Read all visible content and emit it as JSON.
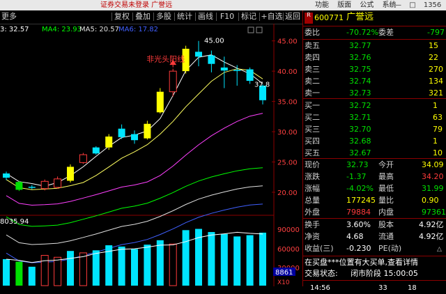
{
  "window": {
    "title": "证券交易未登录  广誉远"
  },
  "menu": [
    "功能",
    "版面",
    "公式",
    "系统"
  ],
  "window_controls": {
    "number": "1356"
  },
  "toolbar": {
    "more": "更多",
    "buttons": [
      "复权",
      "叠加",
      "多股",
      "统计",
      "画线",
      "F10",
      "标记",
      "+自选",
      "返回"
    ]
  },
  "indicator": {
    "ma3": "3: 32.57",
    "ma4": "MA4: 23.93",
    "ma5": "MA5: 20.57",
    "ma6": "MA6: 17.82"
  },
  "volume_label": "8035.94",
  "volume_axis": [
    "90000",
    "60000",
    "30000"
  ],
  "volume_axis_unit": "X10",
  "volume_box": "8861",
  "annotation": "非光头阳线",
  "colors": {
    "up": "#ff3b3b",
    "down": "#00e5ff",
    "yellow_candle": "#ffff00",
    "ma1": "#ffffff",
    "ma2": "#ffff60",
    "ma3": "#ff40ff",
    "ma4": "#00ff00",
    "ma5": "#e0e0e0",
    "ma6": "#4060ff"
  },
  "chart_data": {
    "type": "candlestick",
    "y_ticks": [
      45.0,
      40.0,
      35.0,
      30.0,
      25.0,
      20.0
    ],
    "high_label": "45.00",
    "last_label": "37.8",
    "ylim": [
      17,
      46
    ],
    "candles": [
      {
        "o": 22.4,
        "c": 23.1,
        "h": 23.4,
        "l": 22.0,
        "color": "cyan",
        "vol": 42000
      },
      {
        "o": 21.7,
        "c": 20.4,
        "h": 21.9,
        "l": 20.2,
        "color": "green",
        "vol": 38000
      },
      {
        "o": 20.9,
        "c": 20.8,
        "h": 21.2,
        "l": 20.5,
        "color": "cyan",
        "vol": 30000
      },
      {
        "o": 20.6,
        "c": 21.8,
        "h": 22.1,
        "l": 20.3,
        "color": "red",
        "vol": 48000
      },
      {
        "o": 20.8,
        "c": 22.2,
        "h": 22.6,
        "l": 20.6,
        "color": "red",
        "vol": 45000
      },
      {
        "o": 21.9,
        "c": 24.2,
        "h": 24.6,
        "l": 21.6,
        "color": "yellow",
        "vol": 55000
      },
      {
        "o": 24.9,
        "c": 26.2,
        "h": 26.5,
        "l": 24.7,
        "color": "red",
        "vol": 52000
      },
      {
        "o": 26.4,
        "c": 27.4,
        "h": 27.6,
        "l": 26.2,
        "color": "cyan",
        "vol": 56000
      },
      {
        "o": 27.4,
        "c": 29.2,
        "h": 29.6,
        "l": 27.0,
        "color": "yellow",
        "vol": 64000
      },
      {
        "o": 29.1,
        "c": 30.5,
        "h": 31.2,
        "l": 28.8,
        "color": "cyan",
        "vol": 62000
      },
      {
        "o": 29.6,
        "c": 28.6,
        "h": 30.2,
        "l": 28.0,
        "color": "cyan",
        "vol": 58000
      },
      {
        "o": 28.9,
        "c": 31.3,
        "h": 31.8,
        "l": 28.7,
        "color": "yellow",
        "vol": 65000
      },
      {
        "o": 33.2,
        "c": 36.6,
        "h": 37.2,
        "l": 33.0,
        "color": "yellow",
        "vol": 72000
      },
      {
        "o": 36.6,
        "c": 40.0,
        "h": 40.4,
        "l": 35.8,
        "color": "red",
        "vol": 66000
      },
      {
        "o": 40.0,
        "c": 43.7,
        "h": 44.2,
        "l": 39.6,
        "color": "yellow",
        "vol": 88000
      },
      {
        "o": 42.4,
        "c": 43.2,
        "h": 45.0,
        "l": 40.8,
        "color": "cyan",
        "vol": 90000
      },
      {
        "o": 42.6,
        "c": 41.2,
        "h": 43.4,
        "l": 39.8,
        "color": "cyan",
        "vol": 85000
      },
      {
        "o": 40.6,
        "c": 40.1,
        "h": 42.4,
        "l": 37.2,
        "color": "cyan",
        "vol": 82000
      },
      {
        "o": 40.2,
        "c": 40.2,
        "h": 41.0,
        "l": 37.6,
        "color": "cyan",
        "vol": 78000
      },
      {
        "o": 40.3,
        "c": 38.4,
        "h": 40.6,
        "l": 37.9,
        "color": "cyan",
        "vol": 80000
      },
      {
        "o": 37.6,
        "c": 35.2,
        "h": 37.8,
        "l": 34.5,
        "color": "cyan",
        "vol": 84000
      }
    ]
  },
  "quote": {
    "code": "600771",
    "name": "广誉远",
    "wb": {
      "label": "委比",
      "value": "-70.72%",
      "label2": "委差",
      "value2": "-797"
    },
    "sell": [
      {
        "label": "卖五",
        "price": "32.77",
        "vol": "15"
      },
      {
        "label": "卖四",
        "price": "32.76",
        "vol": "22"
      },
      {
        "label": "卖三",
        "price": "32.75",
        "vol": "270"
      },
      {
        "label": "卖二",
        "price": "32.74",
        "vol": "134"
      },
      {
        "label": "卖一",
        "price": "32.73",
        "vol": "321"
      }
    ],
    "buy": [
      {
        "label": "买一",
        "price": "32.72",
        "vol": "1"
      },
      {
        "label": "买二",
        "price": "32.71",
        "vol": "63"
      },
      {
        "label": "买三",
        "price": "32.70",
        "vol": "79"
      },
      {
        "label": "买四",
        "price": "32.68",
        "vol": "1"
      },
      {
        "label": "买五",
        "price": "32.67",
        "vol": "10"
      }
    ],
    "stats": [
      {
        "l1": "现价",
        "v1": "32.73",
        "c1": "green",
        "l2": "今开",
        "v2": "34.09",
        "c2": "yellow"
      },
      {
        "l1": "涨跌",
        "v1": "-1.37",
        "c1": "green",
        "l2": "最高",
        "v2": "34.20",
        "c2": "red"
      },
      {
        "l1": "涨幅",
        "v1": "-4.02%",
        "c1": "green",
        "l2": "最低",
        "v2": "31.99",
        "c2": "green"
      },
      {
        "l1": "总量",
        "v1": "177245",
        "c1": "yellow",
        "l2": "量比",
        "v2": "0.90",
        "c2": "yellow"
      },
      {
        "l1": "外盘",
        "v1": "79884",
        "c1": "red",
        "l2": "内盘",
        "v2": "97361",
        "c2": "green"
      }
    ],
    "fund": [
      {
        "l1": "换手",
        "v1": "3.60%",
        "l2": "股本",
        "v2": "4.92亿"
      },
      {
        "l1": "净资",
        "v1": "4.68",
        "l2": "流通",
        "v2": "4.92亿"
      },
      {
        "l1": "收益(三)",
        "v1": "-0.230",
        "l2": "PE(动)",
        "v2": ""
      }
    ],
    "notice": "在买盘***位置有大买单,查看详情",
    "status": {
      "label": "交易状态:",
      "value": "闭市阶段 15:00:05"
    },
    "bottom": {
      "time": "14:56",
      "price": "33",
      "extra": "18"
    }
  }
}
